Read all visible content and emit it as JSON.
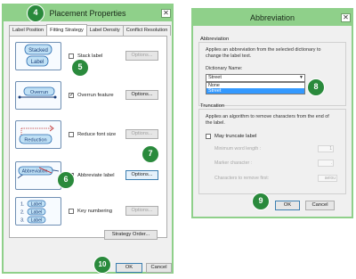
{
  "placement": {
    "title": "Placement Properties",
    "close": "✕",
    "tabs": [
      "Label Position",
      "Fitting Strategy",
      "Label Density",
      "Conflict Resolution"
    ],
    "rows": [
      {
        "thumb": [
          "Stacked",
          "Label"
        ],
        "label": "Stack label",
        "checked": false,
        "options": "Options...",
        "options_enabled": false
      },
      {
        "thumb": [
          "Overrun"
        ],
        "label": "Overrun feature",
        "checked": true,
        "options": "Options...",
        "options_enabled": true
      },
      {
        "thumb": [
          "Reduction"
        ],
        "label": "Reduce font size",
        "checked": false,
        "options": "Options...",
        "options_enabled": false
      },
      {
        "thumb": [
          "Abbreviation"
        ],
        "label": "Abbreviate label",
        "checked": true,
        "options": "Options...",
        "options_enabled": true
      },
      {
        "thumb": [
          "1.",
          "Label",
          "2.",
          "Label",
          "3.",
          "Label"
        ],
        "label": "Key numbering",
        "checked": false,
        "options": "Options...",
        "options_enabled": false
      }
    ],
    "strategy_order": "Strategy Order...",
    "ok": "OK",
    "cancel": "Cancel",
    "check_mark": "✓"
  },
  "abbreviation": {
    "title": "Abbreviation",
    "close": "✕",
    "section_abbr": "Abbreviation",
    "abbr_desc_1": "Applies an abbreviation from the selected dictionary to",
    "abbr_desc_2": "change the label text.",
    "dict_label": "Dictionary Name:",
    "dict_value": "Street",
    "dict_chevron": "▼",
    "dict_options": [
      "None",
      "Street"
    ],
    "dict_selected": "Street",
    "section_trunc": "Truncation",
    "trunc_desc_1": "Applies an algorithm to remove characters from the end of",
    "trunc_desc_2": "the label.",
    "may_truncate": "May truncate label",
    "min_word_length_label": "Minimum word length :",
    "min_word_length_value": "1",
    "marker_char_label": "Marker character :",
    "marker_char_value": ".",
    "chars_remove_label": "Characters to remove first:",
    "chars_remove_value": "aeiou",
    "ok": "OK",
    "cancel": "Cancel"
  },
  "badges": [
    "4",
    "5",
    "7",
    "6",
    "8",
    "9",
    "10"
  ],
  "colors": {
    "frame": "#8fd08a",
    "badge": "#2a8a3c",
    "selection": "#3399ff"
  }
}
